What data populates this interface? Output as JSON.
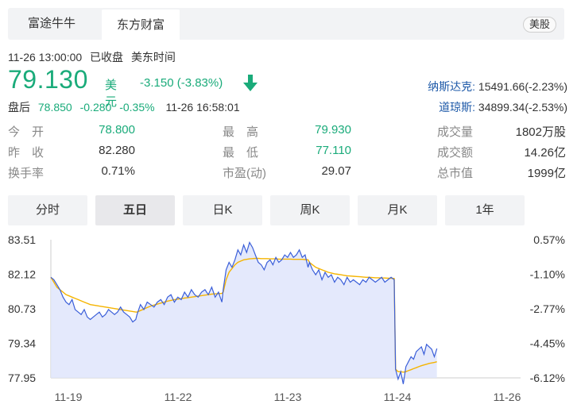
{
  "tabs": [
    {
      "label": "富途牛牛"
    },
    {
      "label": "东方财富"
    }
  ],
  "market_badge": "美股",
  "quote": {
    "timestamp": "11-26 13:00:00",
    "status": "已收盘",
    "timezone": "美东时间",
    "price": "79.130",
    "currency": "美元",
    "change": "-3.150 (-3.83%)",
    "direction_icon": "down-arrow-icon",
    "after_hours": {
      "label": "盘后",
      "price": "78.850",
      "change": "-0.280",
      "pct": "-0.35%",
      "time": "11-26 16:58:01"
    }
  },
  "indices": [
    {
      "name": "纳斯达克:",
      "value": "15491.66(-2.23%)"
    },
    {
      "name": "道琼斯:",
      "value": "34899.34(-2.53%)"
    }
  ],
  "stats": [
    [
      {
        "label": "今　开",
        "value": "78.800",
        "color": "green"
      },
      {
        "label": "最　高",
        "value": "79.930",
        "color": "green"
      },
      {
        "label": "成交量",
        "value": "1802万股",
        "color": "dark"
      }
    ],
    [
      {
        "label": "昨　收",
        "value": "82.280",
        "color": "dark"
      },
      {
        "label": "最　低",
        "value": "77.110",
        "color": "green"
      },
      {
        "label": "成交额",
        "value": "14.26亿",
        "color": "dark"
      }
    ],
    [
      {
        "label": "换手率",
        "value": "0.71%",
        "color": "dark"
      },
      {
        "label": "市盈(动)",
        "value": "29.07",
        "color": "dark"
      },
      {
        "label": "总市值",
        "value": "1999亿",
        "color": "dark"
      }
    ]
  ],
  "period_tabs": [
    {
      "label": "分时",
      "active": false
    },
    {
      "label": "五日",
      "active": true
    },
    {
      "label": "日K",
      "active": false
    },
    {
      "label": "周K",
      "active": false
    },
    {
      "label": "月K",
      "active": false
    },
    {
      "label": "1年",
      "active": false
    }
  ],
  "colors": {
    "green": "#1aab7a",
    "price_line": "#3b5fd9",
    "avg_line": "#f5b400",
    "area_fill": "#dfe5fb",
    "index_link": "#1d59a8"
  },
  "chart_data": {
    "type": "line",
    "y_ticks_left": [
      "83.51",
      "82.12",
      "80.73",
      "79.34",
      "77.95"
    ],
    "y_ticks_right": [
      "0.57%",
      "-1.10%",
      "-2.77%",
      "-4.45%",
      "-6.12%"
    ],
    "ylim": [
      77.95,
      83.51
    ],
    "x_ticks": [
      "11-19",
      "11-22",
      "11-23",
      "11-24",
      "11-26"
    ],
    "sessions": 5,
    "series": [
      {
        "kind": "price",
        "values": [
          82.0,
          81.9,
          81.7,
          81.5,
          81.2,
          81.0,
          80.9,
          81.1,
          80.7,
          80.6,
          80.5,
          80.7,
          80.4,
          80.3,
          80.4,
          80.5,
          80.6,
          80.4,
          80.5,
          80.7,
          80.6,
          80.5,
          80.6,
          80.8,
          80.6,
          80.5,
          80.4,
          80.2,
          80.3,
          80.5,
          80.9,
          80.7,
          81.0,
          80.9,
          80.8,
          81.0,
          81.1,
          80.9,
          81.2,
          81.3,
          81.0,
          81.2,
          81.1,
          81.4,
          81.2,
          81.5,
          81.3,
          81.2,
          81.4,
          81.5,
          81.3,
          81.6,
          81.2,
          81.4,
          81.0,
          81.5,
          82.3,
          82.6,
          82.4,
          82.7,
          83.1,
          82.9,
          83.3,
          83.0,
          83.4,
          83.2,
          82.9,
          82.6,
          82.5,
          82.3,
          82.6,
          82.7,
          82.5,
          82.8,
          82.6,
          82.7,
          82.9,
          82.8,
          83.0,
          82.8,
          82.9,
          83.1,
          82.8,
          82.9,
          82.4,
          82.6,
          82.3,
          82.1,
          82.3,
          81.9,
          82.2,
          82.0,
          82.1,
          81.8,
          82.0,
          81.9,
          81.7,
          82.0,
          81.8,
          81.9,
          81.8,
          81.7,
          81.9,
          81.8,
          82.0,
          81.9,
          81.8,
          81.9,
          82.0,
          81.8,
          81.9,
          82.0,
          81.9,
          78.3,
          77.9,
          78.2,
          77.7,
          78.4,
          78.6,
          78.8,
          78.7,
          79.0,
          79.1,
          79.2,
          78.9,
          79.3,
          79.2,
          79.1,
          78.8,
          79.13
        ],
        "sessions": [
          [
            0,
            28
          ],
          [
            29,
            54
          ],
          [
            55,
            84
          ],
          [
            85,
            112
          ],
          [
            113,
            129
          ]
        ]
      },
      {
        "kind": "average",
        "values": [
          82.0,
          81.8,
          81.6,
          81.5,
          81.4,
          81.3,
          81.25,
          81.2,
          81.15,
          81.1,
          81.05,
          81.0,
          80.95,
          80.9,
          80.88,
          80.86,
          80.84,
          80.82,
          80.8,
          80.78,
          80.76,
          80.74,
          80.72,
          80.7,
          80.68,
          80.66,
          80.64,
          80.62,
          80.6,
          80.6,
          80.66,
          80.72,
          80.78,
          80.84,
          80.88,
          80.92,
          80.96,
          81.0,
          81.04,
          81.07,
          81.1,
          81.12,
          81.14,
          81.16,
          81.18,
          81.2,
          81.22,
          81.24,
          81.26,
          81.28,
          81.3,
          81.32,
          81.33,
          81.34,
          81.35,
          81.4,
          81.9,
          82.2,
          82.35,
          82.5,
          82.6,
          82.65,
          82.7,
          82.72,
          82.74,
          82.75,
          82.76,
          82.76,
          82.75,
          82.75,
          82.75,
          82.74,
          82.74,
          82.74,
          82.73,
          82.73,
          82.73,
          82.73,
          82.73,
          82.72,
          82.72,
          82.72,
          82.72,
          82.71,
          82.7,
          82.6,
          82.5,
          82.4,
          82.35,
          82.3,
          82.25,
          82.2,
          82.17,
          82.14,
          82.12,
          82.1,
          82.08,
          82.06,
          82.05,
          82.04,
          82.03,
          82.02,
          82.01,
          82.0,
          82.0,
          81.99,
          81.98,
          81.98,
          81.97,
          81.97,
          81.96,
          81.96,
          81.95,
          78.3,
          78.2,
          78.2,
          78.18,
          78.2,
          78.24,
          78.28,
          78.32,
          78.36,
          78.4,
          78.44,
          78.47,
          78.5,
          78.53,
          78.55,
          78.57,
          78.6
        ]
      }
    ]
  }
}
